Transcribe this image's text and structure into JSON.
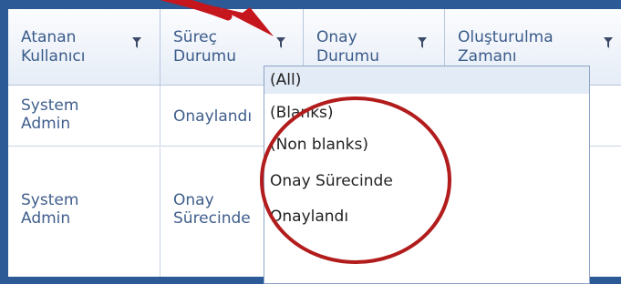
{
  "columns": [
    {
      "label": "Atanan\nKullanıcı",
      "filter_icon": "filter-icon"
    },
    {
      "label": "Süreç\nDurumu",
      "filter_icon": "filter-icon"
    },
    {
      "label": "Onay\nDurumu",
      "filter_icon": "filter-icon"
    },
    {
      "label": "Oluşturulma\nZamanı",
      "filter_icon": "filter-icon"
    }
  ],
  "rows": [
    {
      "user": "System\nAdmin",
      "process": "Onaylandı"
    },
    {
      "user": "System\nAdmin",
      "process": "Onay\nSürecinde"
    }
  ],
  "filter_menu": {
    "options": [
      "(All)",
      "(Blanks)",
      "(Non blanks)",
      "Onay Sürecinde",
      "Onaylandı"
    ],
    "selected_index": 0
  },
  "colors": {
    "frame": "#2b5a96",
    "header_text": "#3b5b8a",
    "annotation_red": "#c4161c",
    "circle_red": "#b21c1c"
  }
}
